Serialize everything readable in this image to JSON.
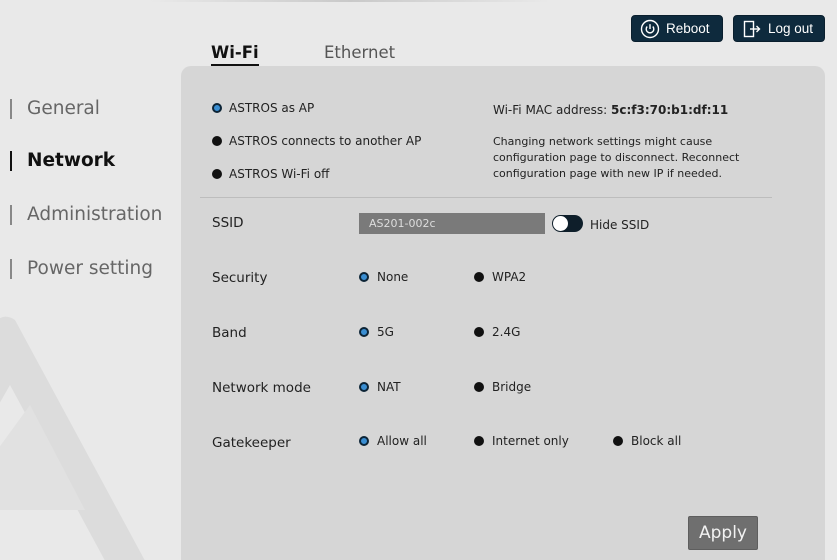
{
  "header": {
    "reboot_label": "Reboot",
    "logout_label": "Log out"
  },
  "tabs": [
    {
      "label": "Wi-Fi",
      "active": true
    },
    {
      "label": "Ethernet",
      "active": false
    }
  ],
  "sidebar": {
    "items": [
      {
        "label": "General",
        "active": false
      },
      {
        "label": "Network",
        "active": true
      },
      {
        "label": "Administration",
        "active": false
      },
      {
        "label": "Power setting",
        "active": false
      }
    ]
  },
  "wifi_mode": {
    "options": [
      {
        "label": "ASTROS as AP",
        "selected": true
      },
      {
        "label": "ASTROS connects to another AP",
        "selected": false
      },
      {
        "label": "ASTROS Wi-Fi off",
        "selected": false
      }
    ]
  },
  "mac": {
    "label": "Wi-Fi MAC address:",
    "value": "5c:f3:70:b1:df:11"
  },
  "note": "Changing network settings might cause configuration page to disconnect. Reconnect configuration page with new IP if needed.",
  "ssid": {
    "label": "SSID",
    "value": "AS201-002c",
    "hide_label": "Hide SSID",
    "hide_enabled": false
  },
  "security": {
    "label": "Security",
    "options": [
      {
        "label": "None",
        "selected": true
      },
      {
        "label": "WPA2",
        "selected": false
      }
    ]
  },
  "band": {
    "label": "Band",
    "options": [
      {
        "label": "5G",
        "selected": true
      },
      {
        "label": "2.4G",
        "selected": false
      }
    ]
  },
  "network_mode": {
    "label": "Network mode",
    "options": [
      {
        "label": "NAT",
        "selected": true
      },
      {
        "label": "Bridge",
        "selected": false
      }
    ]
  },
  "gatekeeper": {
    "label": "Gatekeeper",
    "options": [
      {
        "label": "Allow all",
        "selected": true
      },
      {
        "label": "Internet only",
        "selected": false
      },
      {
        "label": "Block all",
        "selected": false
      }
    ]
  },
  "apply_label": "Apply",
  "colors": {
    "header_button": "#0e2a3d",
    "radio_selected": "#3a8ed2",
    "panel": "#d6d6d6",
    "apply_button": "#6f6f6f"
  }
}
